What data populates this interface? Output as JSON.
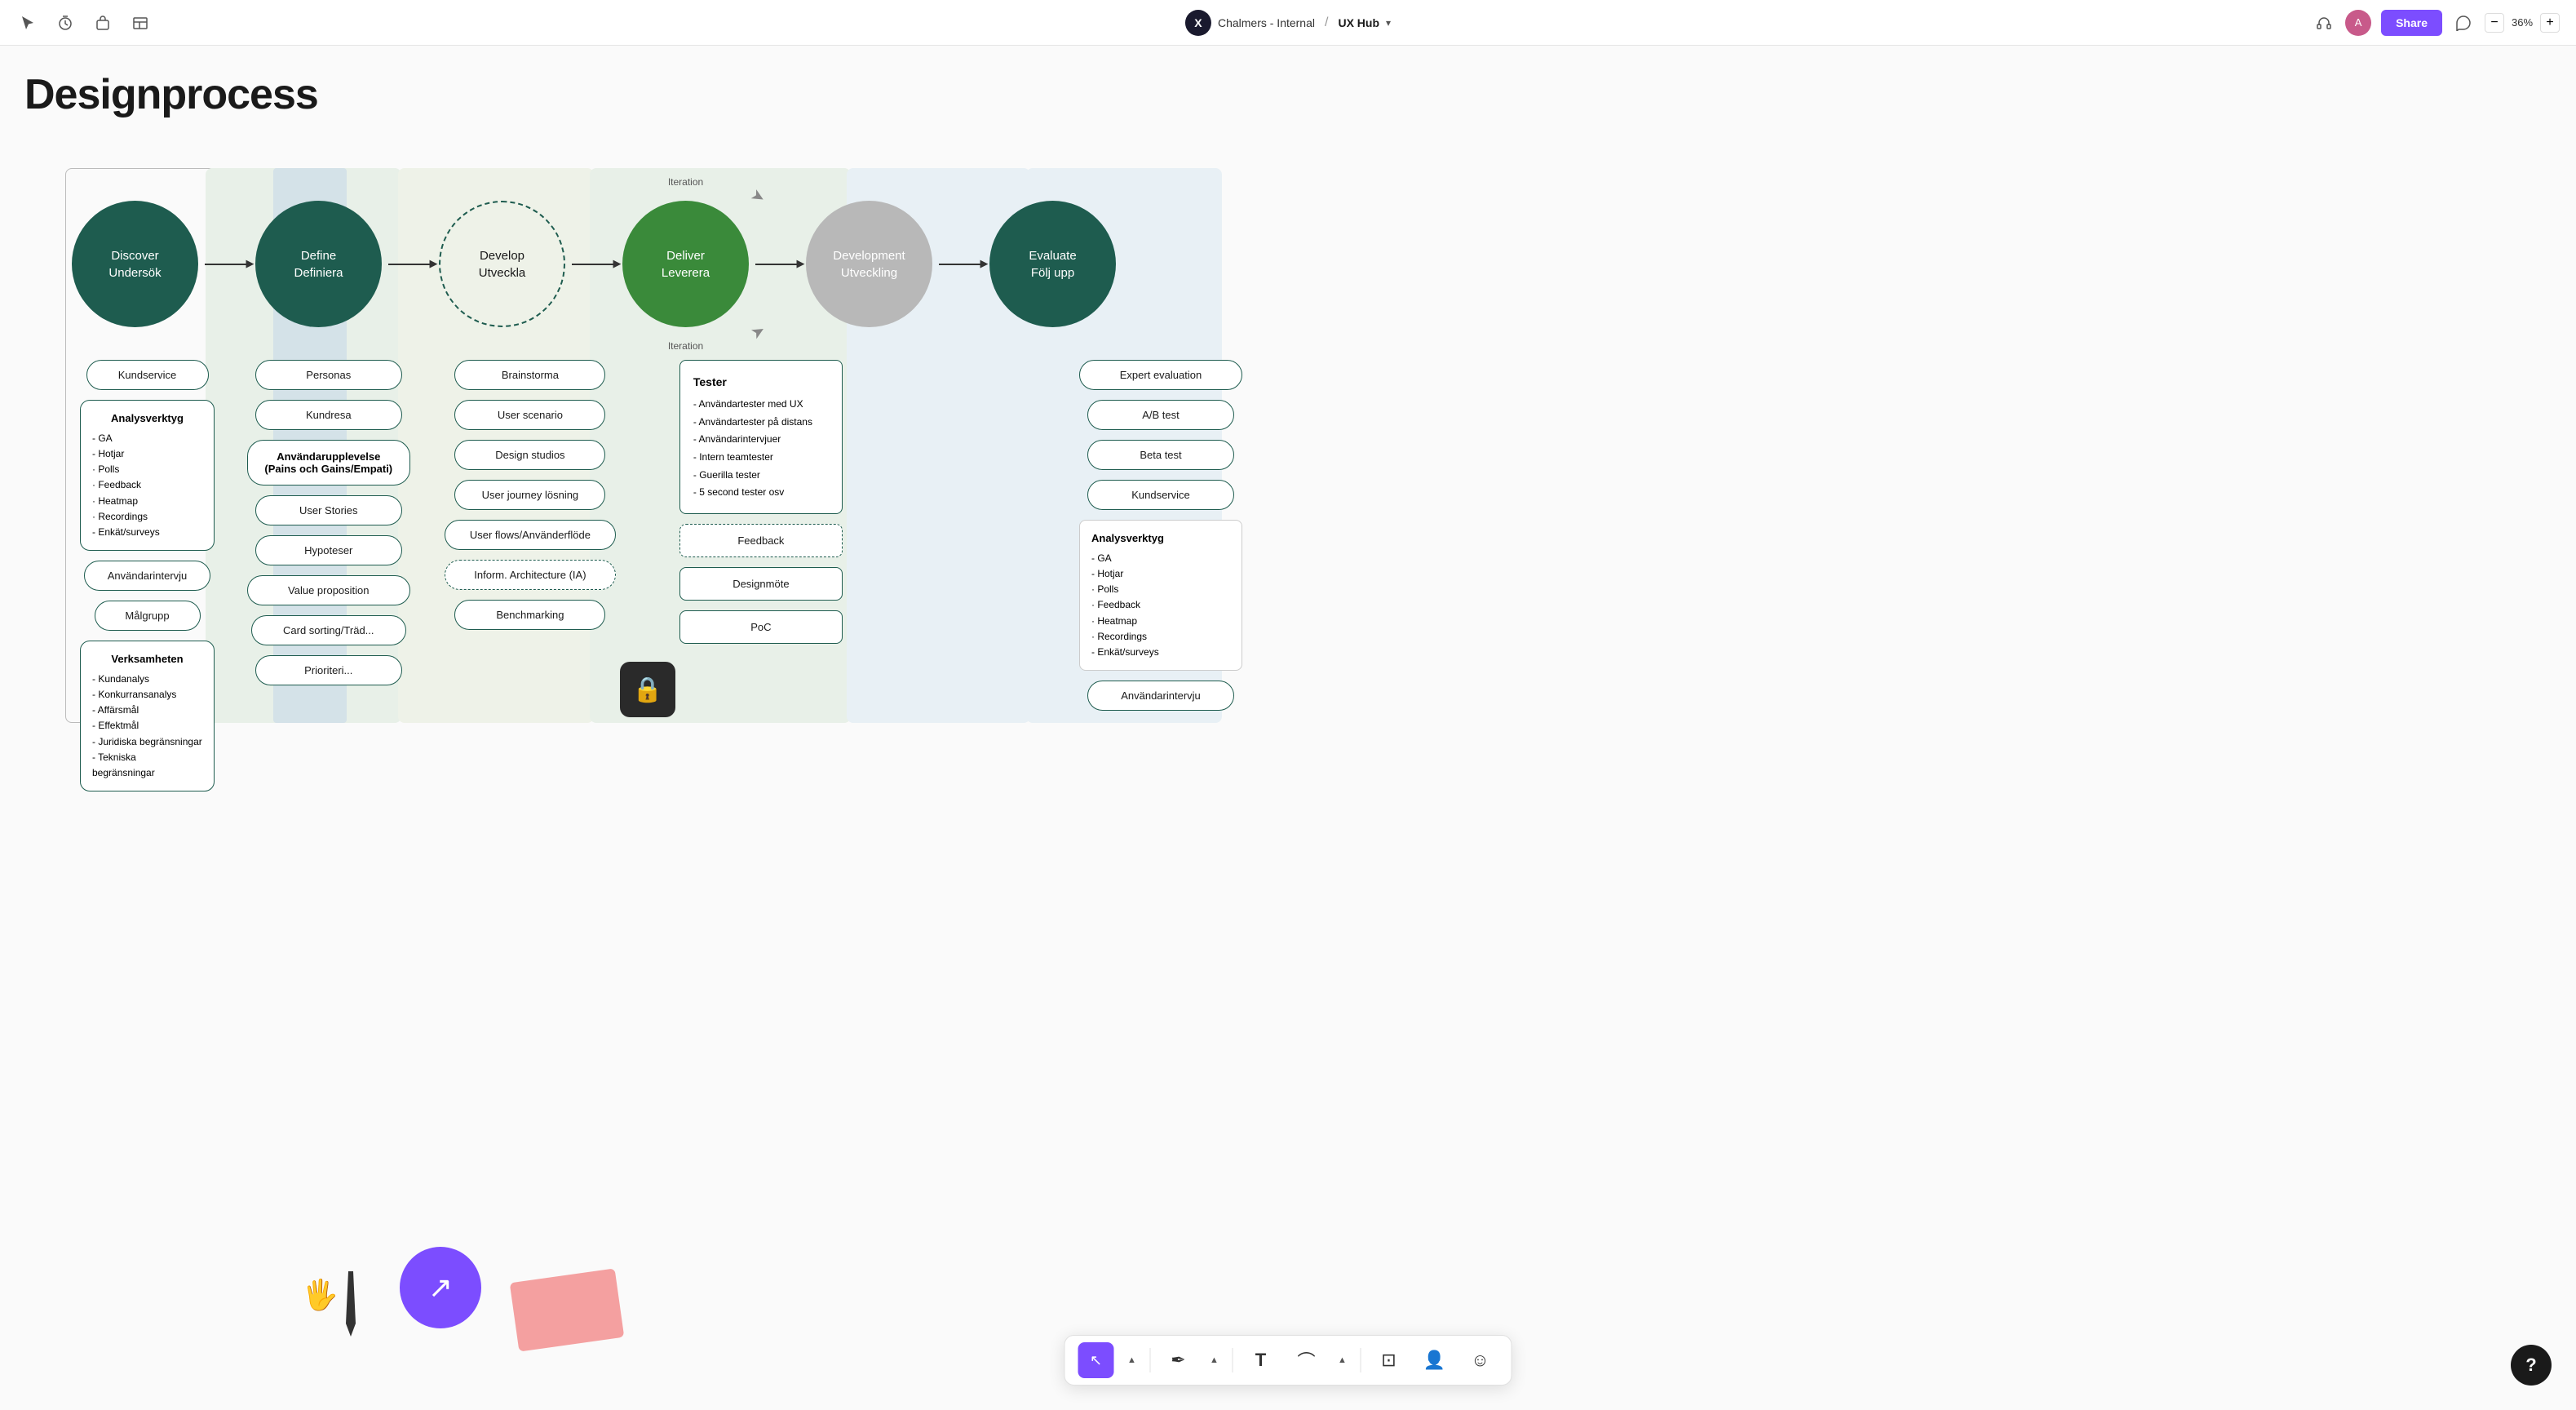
{
  "app": {
    "title": "Designprocess",
    "breadcrumb_logo": "X",
    "breadcrumb_org": "Chalmers - Internal",
    "breadcrumb_sep": "/",
    "breadcrumb_hub": "UX Hub",
    "share_label": "Share",
    "zoom_value": "36%",
    "zoom_minus": "−",
    "zoom_plus": "+"
  },
  "phases": [
    {
      "id": "discover",
      "circle_line1": "Discover",
      "circle_line2": "Undersök",
      "type": "dark-green"
    },
    {
      "id": "define",
      "circle_line1": "Define",
      "circle_line2": "Definiera",
      "type": "dark-green"
    },
    {
      "id": "develop",
      "circle_line1": "Develop",
      "circle_line2": "Utveckla",
      "type": "develop"
    },
    {
      "id": "deliver",
      "circle_line1": "Deliver",
      "circle_line2": "Leverera",
      "type": "bright-green"
    },
    {
      "id": "development",
      "circle_line1": "Development",
      "circle_line2": "Utveckling",
      "type": "gray"
    },
    {
      "id": "evaluate",
      "circle_line1": "Evaluate",
      "circle_line2": "Följ upp",
      "type": "dark-green"
    }
  ],
  "discover_cards": [
    {
      "label": "Kundservice",
      "type": "pill"
    },
    {
      "label": "Analysverktyg",
      "type": "analysis",
      "items": [
        "- GA",
        "- Hotjar",
        "· Polls",
        "· Feedback",
        "· Heatmap",
        "· Recordings",
        "- Enkät/surveys"
      ]
    },
    {
      "label": "Användarintervju",
      "type": "pill"
    },
    {
      "label": "Målgrupp",
      "type": "pill"
    },
    {
      "label": "Verksamheten",
      "type": "verk",
      "items": [
        "- Kundanalys",
        "- Konkurransanalys",
        "- Affärsmål",
        "- Effektmål",
        "- Juridiska begränsningar",
        "- Tekniska begränsningar"
      ]
    }
  ],
  "define_cards": [
    {
      "label": "Personas",
      "type": "pill"
    },
    {
      "label": "Kundresa",
      "type": "pill"
    },
    {
      "label": "Användarupplevelse (Pains och Gains/Empati)",
      "type": "pill-bold"
    },
    {
      "label": "User Stories",
      "type": "pill"
    },
    {
      "label": "Hypoteser",
      "type": "pill"
    },
    {
      "label": "Value proposition",
      "type": "pill"
    },
    {
      "label": "Card sorting/Träd...",
      "type": "pill"
    },
    {
      "label": "Prioriteri...",
      "type": "pill"
    }
  ],
  "develop_cards": [
    {
      "label": "Brainstorma",
      "type": "pill"
    },
    {
      "label": "User scenario",
      "type": "pill"
    },
    {
      "label": "Design studios",
      "type": "pill"
    },
    {
      "label": "User journey lösning",
      "type": "pill"
    },
    {
      "label": "User flows/Använderflöde",
      "type": "pill"
    },
    {
      "label": "Inform. Architecture (IA)",
      "type": "pill-dashed"
    },
    {
      "label": "Benchmarking",
      "type": "pill"
    }
  ],
  "deliver_cards": [
    {
      "label": "Tester",
      "type": "square",
      "items": [
        "- Användartester med UX",
        "- Användartester på distans",
        "- Användarintervjuer",
        "- Intern teamtester",
        "- Guerilla tester",
        "- 5 second tester osv"
      ]
    },
    {
      "label": "Feedback",
      "type": "square-dashed"
    },
    {
      "label": "Designmöte",
      "type": "square"
    },
    {
      "label": "PoC",
      "type": "square"
    }
  ],
  "evaluate_cards": [
    {
      "label": "Expert evaluation",
      "type": "pill"
    },
    {
      "label": "A/B test",
      "type": "pill"
    },
    {
      "label": "Beta test",
      "type": "pill"
    },
    {
      "label": "Kundservice",
      "type": "pill"
    },
    {
      "label": "Analysverktyg",
      "type": "analysis-right",
      "items": [
        "- GA",
        "- Hotjar",
        "· Polls",
        "· Feedback",
        "· Heatmap",
        "· Recordings",
        "- Enkät/surveys"
      ]
    },
    {
      "label": "Användarintervju",
      "type": "pill"
    }
  ],
  "iteration_labels": [
    "Iteration",
    "Iteration"
  ],
  "bottom_toolbar": {
    "tools": [
      {
        "name": "select-tool",
        "icon": "↖",
        "active": true
      },
      {
        "name": "pen-tool",
        "icon": "✒",
        "active": false
      },
      {
        "name": "shape-up-chevron",
        "icon": "▲",
        "active": false
      },
      {
        "name": "text-tool",
        "icon": "T",
        "active": false
      },
      {
        "name": "line-tool",
        "icon": "⌒",
        "active": false
      },
      {
        "name": "shape-up-chevron2",
        "icon": "▲",
        "active": false
      },
      {
        "name": "frame-tool",
        "icon": "⊡",
        "active": false
      },
      {
        "name": "avatar-tool",
        "icon": "👤",
        "active": false
      },
      {
        "name": "emoji-tool",
        "icon": "☺",
        "active": false
      }
    ]
  },
  "help_button": "?"
}
